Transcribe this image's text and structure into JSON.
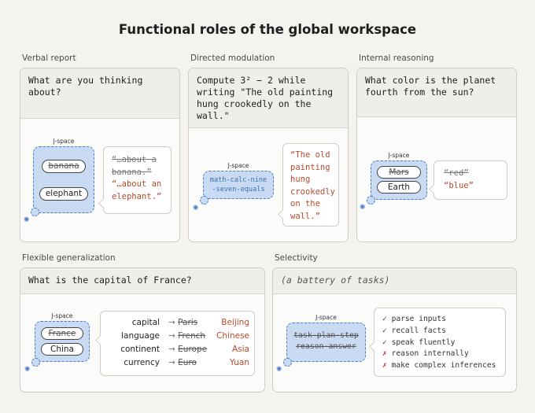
{
  "title": "Functional roles of the global workspace",
  "jspace_label": "J-space",
  "panels": {
    "verbal_report": {
      "label": "Verbal report",
      "prompt": "What are you thinking about?",
      "jspace_words": [
        "banana",
        "elephant"
      ],
      "response_lines": [
        "“…about a banana.”",
        "“…about an elephant.”"
      ]
    },
    "directed_modulation": {
      "label": "Directed modulation",
      "prompt": "Compute 3² − 2 while writing \"The old painting hung crookedly on the wall.\"",
      "jspace_code": [
        "math-calc-nine",
        "-seven-equals"
      ],
      "response": "“The old painting hung crookedly on the wall.”"
    },
    "internal_reasoning": {
      "label": "Internal reasoning",
      "prompt": "What color is the planet fourth from the sun?",
      "jspace_words": [
        "Mars",
        "Earth"
      ],
      "response_lines": [
        "“red”",
        "“blue”"
      ]
    },
    "flexible_generalization": {
      "label": "Flexible generalization",
      "prompt": "What is the capital of France?",
      "jspace_words": [
        "France",
        "China"
      ],
      "arrow": "→",
      "rows": [
        {
          "key": "capital",
          "from": "Paris",
          "to": "Beijing"
        },
        {
          "key": "language",
          "from": "French",
          "to": "Chinese"
        },
        {
          "key": "continent",
          "from": "Europe",
          "to": "Asia"
        },
        {
          "key": "currency",
          "from": "Euro",
          "to": "Yuan"
        }
      ]
    },
    "selectivity": {
      "label": "Selectivity",
      "prompt": "(a battery of tasks)",
      "jspace_tasks": [
        "task-plan-step",
        "reason-answer"
      ],
      "tasks": [
        {
          "mark": "✓",
          "text": "parse inputs",
          "ok": true
        },
        {
          "mark": "✓",
          "text": "recall facts",
          "ok": true
        },
        {
          "mark": "✓",
          "text": "speak fluently",
          "ok": true
        },
        {
          "mark": "✗",
          "text": "reason internally",
          "ok": false
        },
        {
          "mark": "✗",
          "text": "make complex inferences",
          "ok": false
        }
      ]
    }
  },
  "colors": {
    "jspace_fill": "#c9dbf2",
    "jspace_border": "#4d7ec2",
    "response_red": "#b84a2a",
    "background": "#f4f3ee"
  },
  "icons": [
    "gear-icon",
    "check-icon",
    "cross-icon",
    "arrow-right-icon"
  ]
}
